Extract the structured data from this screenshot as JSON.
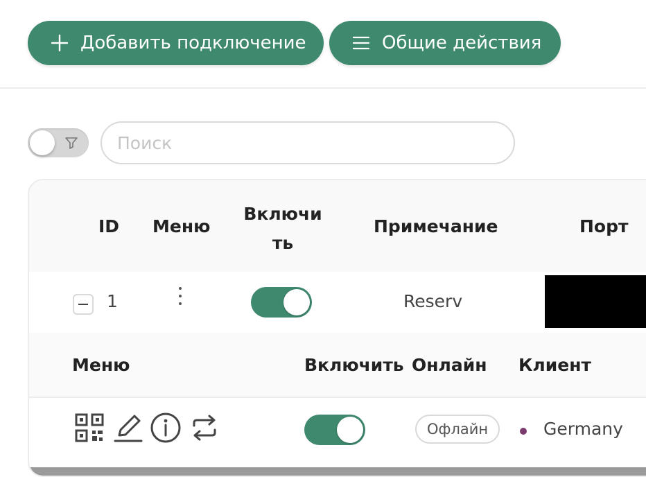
{
  "toolbar": {
    "add_connection_label": "Добавить подключение",
    "general_actions_label": "Общие действия"
  },
  "search": {
    "placeholder": "Поиск",
    "value": ""
  },
  "table": {
    "columns": {
      "id": "ID",
      "menu": "Меню",
      "enable": "Включить",
      "note": "Примечание",
      "port": "Порт"
    },
    "rows": [
      {
        "id": "1",
        "enabled": true,
        "note": "Reserv",
        "port": "[redacted]"
      }
    ]
  },
  "subtable": {
    "columns": {
      "menu": "Меню",
      "enable": "Включить",
      "online": "Онлайн",
      "client": "Клиент"
    },
    "rows": [
      {
        "enabled": true,
        "online_status": "Офлайн",
        "client": "Germany"
      }
    ]
  },
  "colors": {
    "accent": "#3f8a6e",
    "client_dot": "#7a3a6e"
  },
  "icons": [
    "plus-icon",
    "menu-lines-icon",
    "filter-icon",
    "kebab-menu-icon",
    "qrcode-icon",
    "edit-icon",
    "info-icon",
    "reset-icon",
    "collapse-icon"
  ]
}
